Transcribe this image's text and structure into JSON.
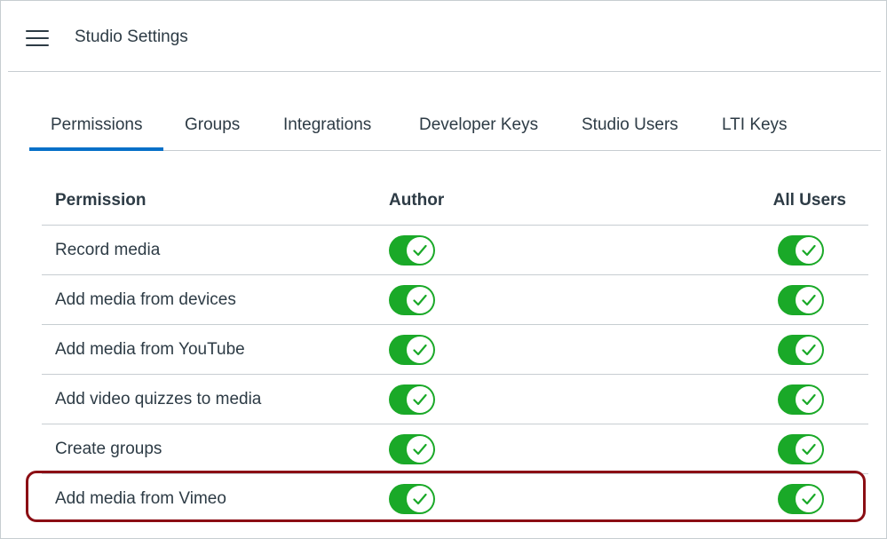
{
  "header": {
    "menu_icon": "hamburger-menu-icon",
    "title": "Studio Settings"
  },
  "tabs": [
    {
      "label": "Permissions",
      "active": true
    },
    {
      "label": "Groups",
      "active": false
    },
    {
      "label": "Integrations",
      "active": false
    },
    {
      "label": "Developer Keys",
      "active": false
    },
    {
      "label": "Studio Users",
      "active": false
    },
    {
      "label": "LTI Keys",
      "active": false
    }
  ],
  "table": {
    "columns": [
      "Permission",
      "Author",
      "All Users"
    ],
    "rows": [
      {
        "permission": "Record media",
        "author": true,
        "all_users": true
      },
      {
        "permission": "Add media from devices",
        "author": true,
        "all_users": true
      },
      {
        "permission": "Add media from YouTube",
        "author": true,
        "all_users": true
      },
      {
        "permission": "Add video quizzes to media",
        "author": true,
        "all_users": true
      },
      {
        "permission": "Create groups",
        "author": true,
        "all_users": true
      },
      {
        "permission": "Add media from Vimeo",
        "author": true,
        "all_users": true,
        "highlighted": true
      }
    ]
  },
  "colors": {
    "toggle_on": "#1aa928",
    "active_tab": "#0770c8",
    "highlight_border": "#8b0e14",
    "text": "#2d3b45",
    "divider": "#c7cdd1"
  }
}
